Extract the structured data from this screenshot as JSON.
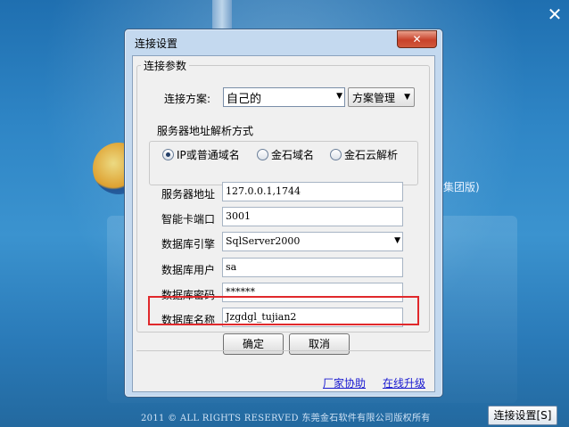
{
  "background": {
    "brand_text": "集团版)",
    "footer_text": "2011 ©  ALL RIGHTS RESERVED 东莞金石软件有限公司版权所有",
    "connection_settings_button": "连接设置[S]",
    "close_glyph": "✕"
  },
  "dialog": {
    "title": "连接设置",
    "close_glyph": "✕",
    "group_title": "连接参数",
    "scheme": {
      "label": "连接方案:",
      "value": "自己的",
      "manage_label": "方案管理"
    },
    "resolve": {
      "title": "服务器地址解析方式",
      "options": [
        "IP或普通域名",
        "金石域名",
        "金石云解析"
      ],
      "selected": "IP或普通域名"
    },
    "fields": {
      "server_label": "服务器地址",
      "server_value": "127.0.0.1,1744",
      "port_label": "智能卡端口",
      "port_value": "3001",
      "engine_label": "数据库引擎",
      "engine_value": "SqlServer2000",
      "user_label": "数据库用户",
      "user_value": "sa",
      "password_label": "数据库密码",
      "password_value": "******",
      "dbname_label": "数据库名称",
      "dbname_value": "Jzgdgl_tujian2"
    },
    "ok_label": "确定",
    "cancel_label": "取消",
    "link_vendor": "厂家协助",
    "link_upgrade": "在线升级"
  },
  "colors": {
    "highlight": "#e0282b",
    "link": "#1a1ad0",
    "close_button": "#c8422a"
  }
}
